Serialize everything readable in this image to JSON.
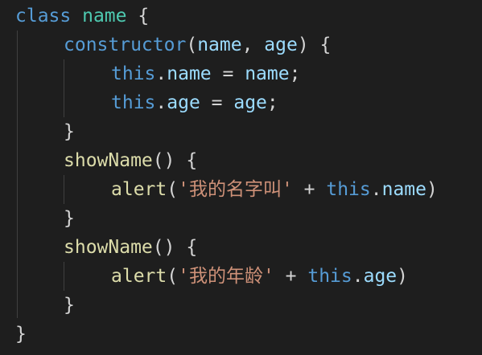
{
  "editor": {
    "background": "#1e1e1e",
    "colors": {
      "keyword": "#569cd6",
      "class_name": "#4ec9b0",
      "function": "#dcdcaa",
      "parameter": "#9cdcfe",
      "property": "#9cdcfe",
      "string": "#ce9178",
      "punctuation": "#d4d4d4",
      "indent_guide": "#404040"
    },
    "lines": [
      [
        "class",
        " ",
        "name",
        " ",
        "{"
      ],
      [
        "constructor",
        "(",
        "name",
        ", ",
        "age",
        ") ",
        "{"
      ],
      [
        "this",
        ".",
        "name",
        " = ",
        "name",
        ";"
      ],
      [
        "this",
        ".",
        "age",
        " = ",
        "age",
        ";"
      ],
      [
        "}"
      ],
      [
        "showName",
        "() ",
        "{"
      ],
      [
        "alert",
        "(",
        "'我的名字叫'",
        " + ",
        "this",
        ".",
        "name",
        ")"
      ],
      [
        "}"
      ],
      [
        "showName",
        "() ",
        "{"
      ],
      [
        "alert",
        "(",
        "'我的年龄'",
        " + ",
        "this",
        ".",
        "age",
        ")"
      ],
      [
        "}"
      ],
      [
        "}"
      ]
    ]
  }
}
